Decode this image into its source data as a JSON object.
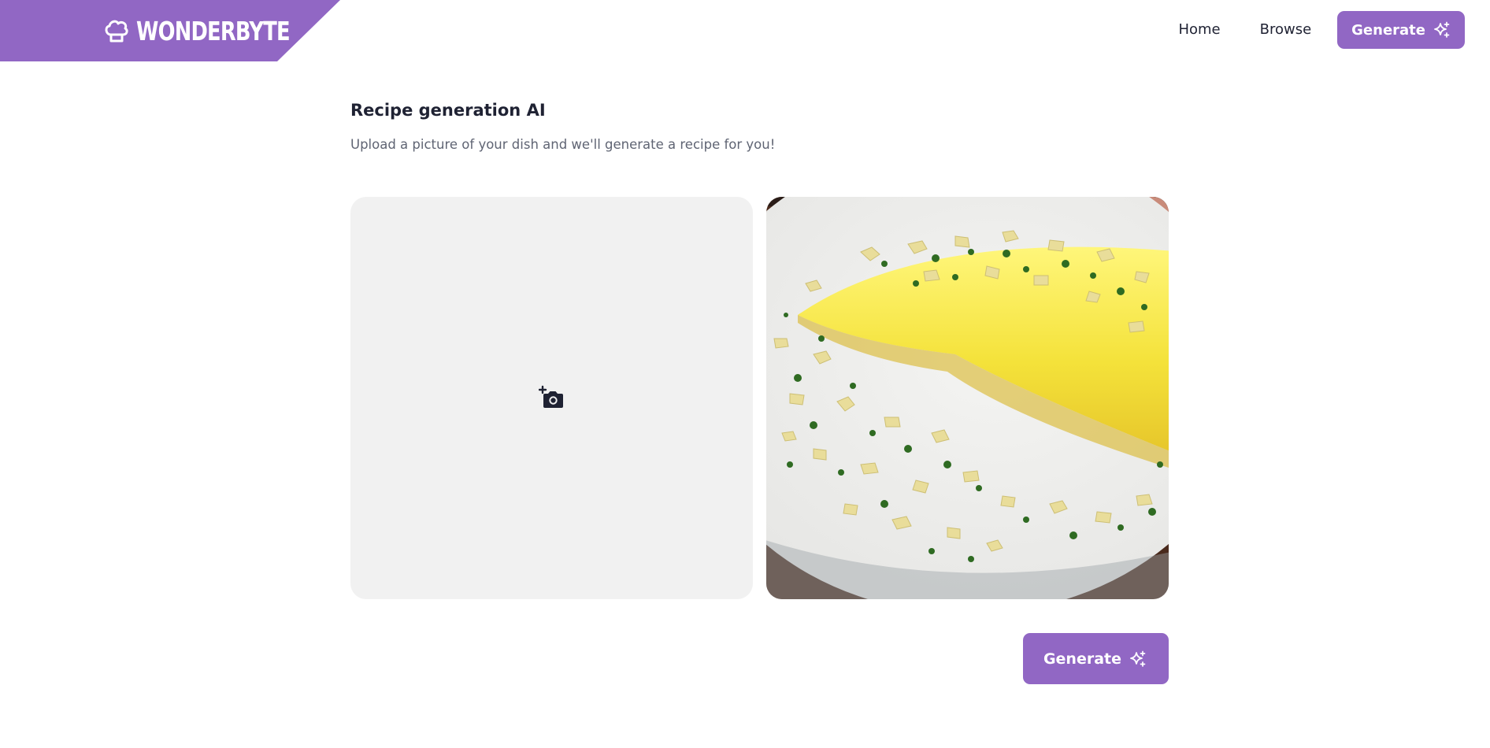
{
  "header": {
    "brand_name": "WONDERBYTE",
    "brand_icon": "chef-hat-icon",
    "nav": {
      "home_label": "Home",
      "browse_label": "Browse",
      "generate_label": "Generate",
      "generate_icon": "sparkles-icon"
    }
  },
  "main": {
    "title": "Recipe generation AI",
    "subtitle": "Upload a picture of your dish and we'll generate a recipe for you!",
    "upload_icon": "add-photo-icon",
    "generate_label": "Generate",
    "generate_icon": "sparkles-icon"
  },
  "colors": {
    "accent": "#9167c4",
    "panel_bg": "#f1f1f1",
    "text": "#1f2233",
    "muted_text": "#5f6473"
  }
}
